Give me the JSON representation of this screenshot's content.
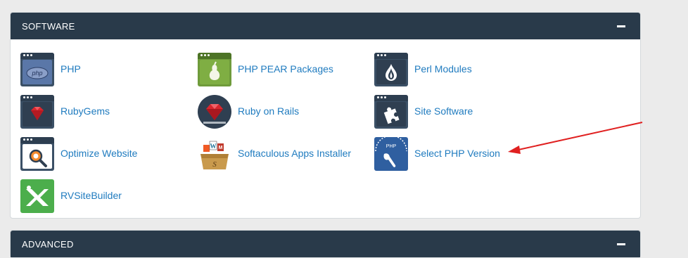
{
  "software_section": {
    "title": "SOFTWARE",
    "toggle": "collapse",
    "items": [
      {
        "label": "PHP",
        "icon": "php-icon"
      },
      {
        "label": "PHP PEAR Packages",
        "icon": "pear-icon"
      },
      {
        "label": "Perl Modules",
        "icon": "perl-onion-icon"
      },
      {
        "label": "RubyGems",
        "icon": "ruby-gem-icon"
      },
      {
        "label": "Ruby on Rails",
        "icon": "ruby-rails-icon"
      },
      {
        "label": "Site Software",
        "icon": "puzzle-icon"
      },
      {
        "label": "Optimize Website",
        "icon": "optimize-icon"
      },
      {
        "label": "Softaculous Apps Installer",
        "icon": "softaculous-icon"
      },
      {
        "label": "Select PHP Version",
        "icon": "select-php-icon"
      },
      {
        "label": "RVSiteBuilder",
        "icon": "rvsitebuilder-icon"
      }
    ]
  },
  "advanced_section": {
    "title": "ADVANCED",
    "toggle": "collapse"
  },
  "colors": {
    "header_bg": "#293a4a",
    "link": "#1f7bbf",
    "annotation_arrow": "#e02020"
  }
}
